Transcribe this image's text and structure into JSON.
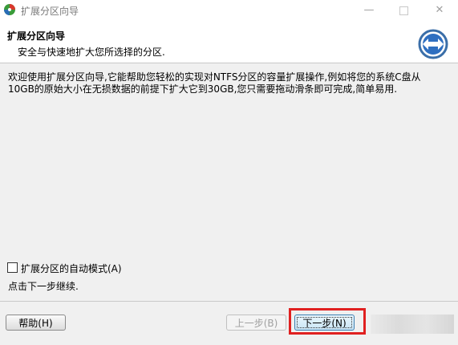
{
  "window": {
    "title": "扩展分区向导",
    "minimize_glyph": "—",
    "close_glyph": "✕"
  },
  "header": {
    "title": "扩展分区向导",
    "subtitle": "安全与快速地扩大您所选择的分区.",
    "icon": "expand-arrows-icon"
  },
  "content": {
    "description": "欢迎使用扩展分区向导,它能帮助您轻松的实现对NTFS分区的容量扩展操作,例如将您的系统C盘从 10GB的原始大小在无损数据的前提下扩大它到30GB,您只需要拖动滑条即可完成,简单易用.",
    "auto_mode_label": "扩展分区的自动模式(A)",
    "auto_mode_checked": false,
    "hint": "点击下一步继续."
  },
  "buttons": {
    "help": "帮助(H)",
    "prev": "上一步(B)",
    "next": "下一步(N)"
  },
  "colors": {
    "highlight": "#e02020",
    "accent": "#2a6db5"
  }
}
